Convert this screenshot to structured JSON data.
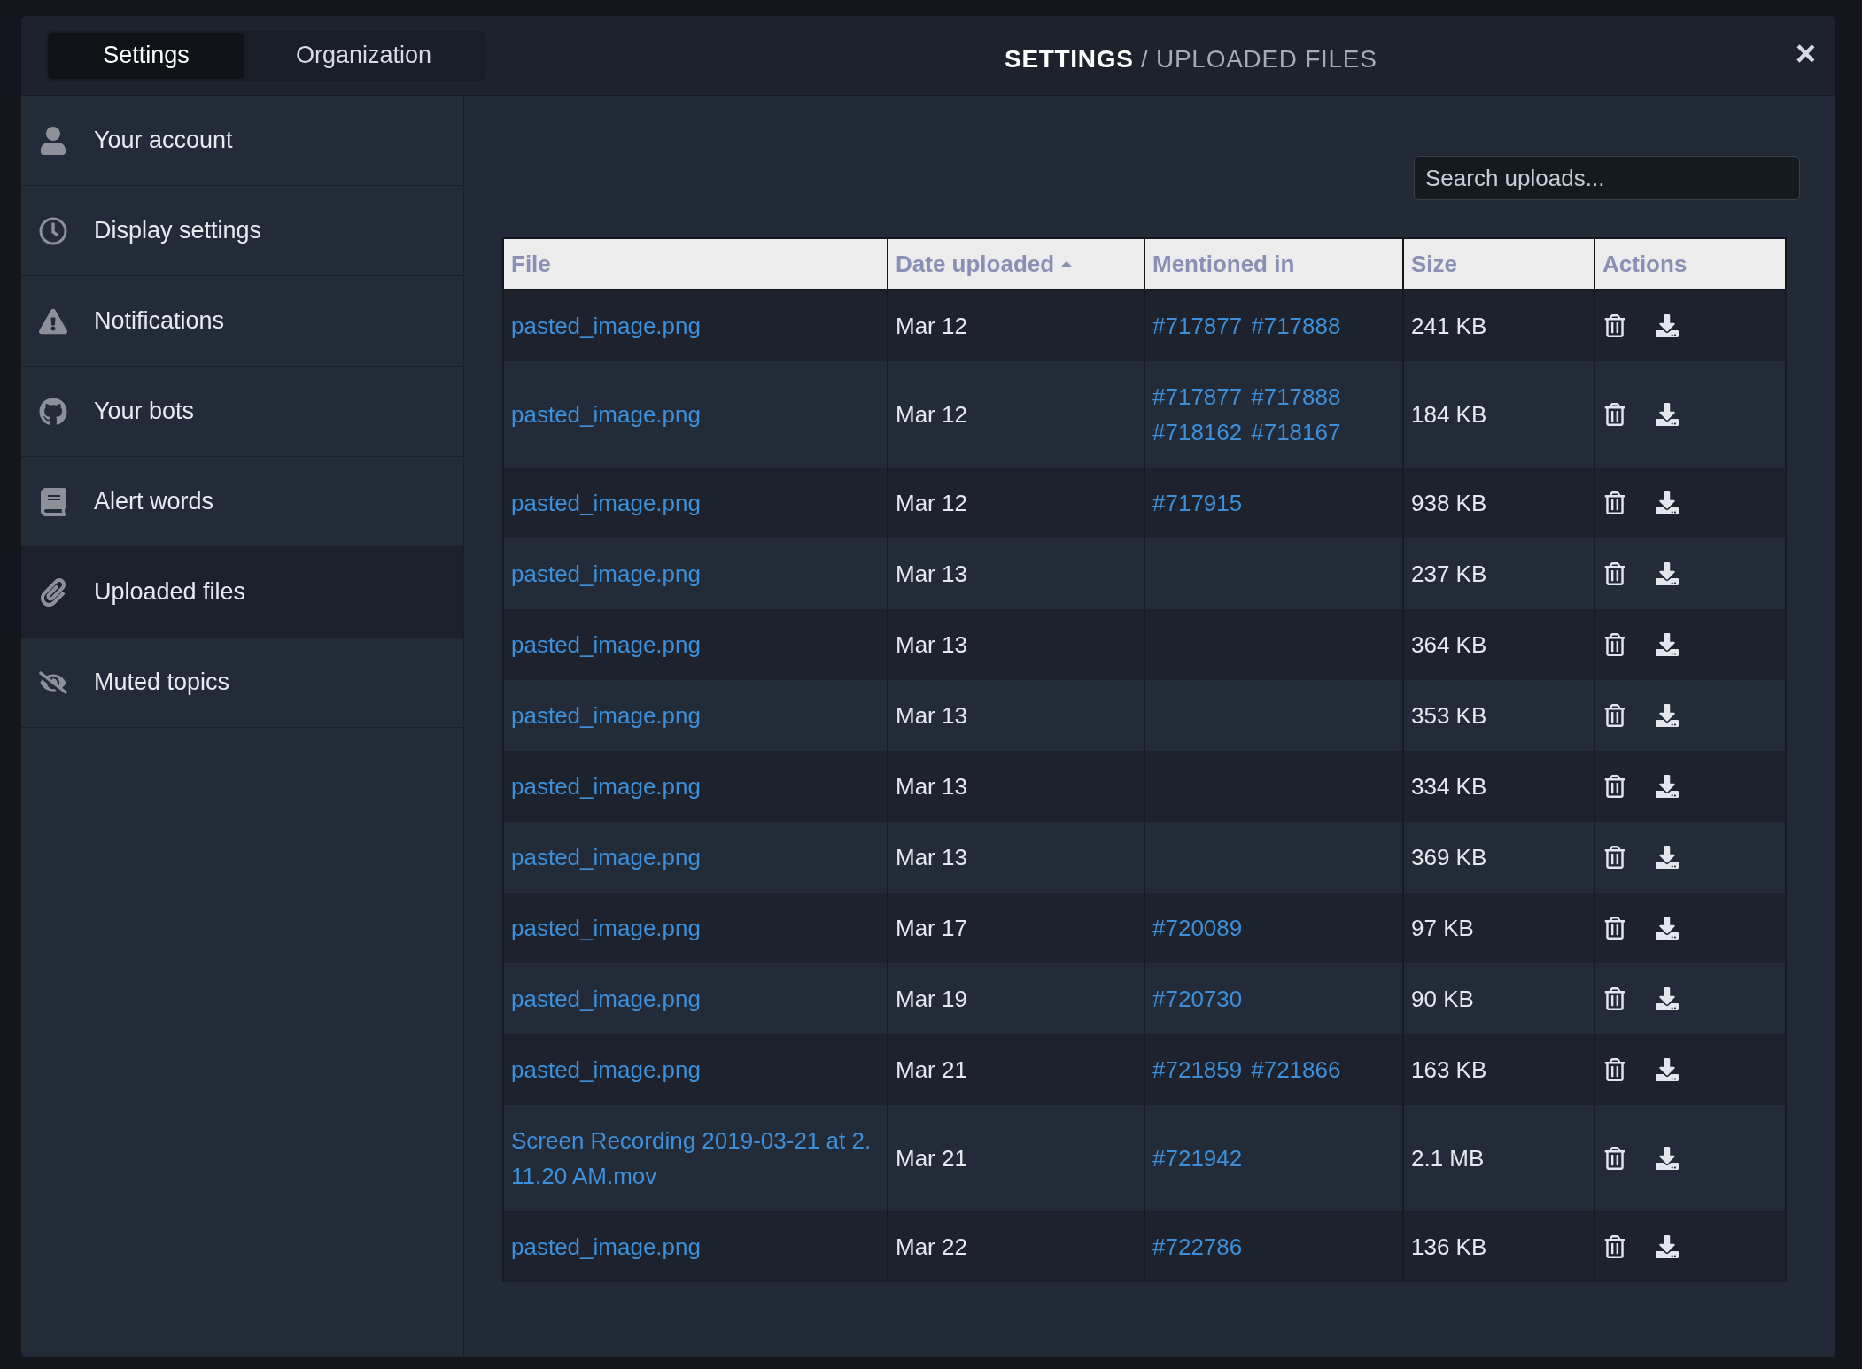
{
  "tabs": [
    {
      "label": "Settings",
      "selected": true
    },
    {
      "label": "Organization",
      "selected": false
    }
  ],
  "title": {
    "section": "SETTINGS",
    "separator": "/",
    "page": "UPLOADED FILES"
  },
  "close": "×",
  "sidebar": {
    "items": [
      {
        "label": "Your account",
        "selected": false
      },
      {
        "label": "Display settings",
        "selected": false
      },
      {
        "label": "Notifications",
        "selected": false
      },
      {
        "label": "Your bots",
        "selected": false
      },
      {
        "label": "Alert words",
        "selected": false
      },
      {
        "label": "Uploaded files",
        "selected": true
      },
      {
        "label": "Muted topics",
        "selected": false
      }
    ]
  },
  "search": {
    "placeholder": "Search uploads..."
  },
  "table": {
    "columns": [
      "File",
      "Date uploaded",
      "Mentioned in",
      "Size",
      "Actions"
    ],
    "rows": [
      {
        "file": "pasted_image.png",
        "date": "Mar 12",
        "mentions": [
          "#717877",
          "#717888"
        ],
        "size": "241 KB"
      },
      {
        "file": "pasted_image.png",
        "date": "Mar 12",
        "mentions": [
          "#717877",
          "#717888",
          "#718162",
          "#718167"
        ],
        "size": "184 KB"
      },
      {
        "file": "pasted_image.png",
        "date": "Mar 12",
        "mentions": [
          "#717915"
        ],
        "size": "938 KB"
      },
      {
        "file": "pasted_image.png",
        "date": "Mar 13",
        "mentions": [],
        "size": "237 KB"
      },
      {
        "file": "pasted_image.png",
        "date": "Mar 13",
        "mentions": [],
        "size": "364 KB"
      },
      {
        "file": "pasted_image.png",
        "date": "Mar 13",
        "mentions": [],
        "size": "353 KB"
      },
      {
        "file": "pasted_image.png",
        "date": "Mar 13",
        "mentions": [],
        "size": "334 KB"
      },
      {
        "file": "pasted_image.png",
        "date": "Mar 13",
        "mentions": [],
        "size": "369 KB"
      },
      {
        "file": "pasted_image.png",
        "date": "Mar 17",
        "mentions": [
          "#720089"
        ],
        "size": "97 KB"
      },
      {
        "file": "pasted_image.png",
        "date": "Mar 19",
        "mentions": [
          "#720730"
        ],
        "size": "90 KB"
      },
      {
        "file": "pasted_image.png",
        "date": "Mar 21",
        "mentions": [
          "#721859",
          "#721866"
        ],
        "size": "163 KB"
      },
      {
        "file": "Screen Recording 2019-03-21 at 2.11.20 AM.mov",
        "date": "Mar 21",
        "mentions": [
          "#721942"
        ],
        "size": "2.1 MB"
      },
      {
        "file": "pasted_image.png",
        "date": "Mar 22",
        "mentions": [
          "#722786"
        ],
        "size": "136 KB"
      }
    ]
  }
}
